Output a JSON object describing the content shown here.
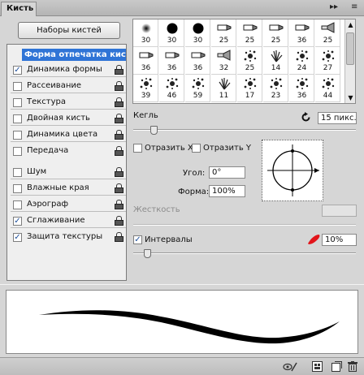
{
  "panel": {
    "tab_label": "Кисть",
    "menu_arrows": "▸▸",
    "menu_icon": "≡"
  },
  "presets_button": "Наборы кистей",
  "options": {
    "header": "Форма отпечатка кисти",
    "items": [
      {
        "label": "Динамика формы",
        "checked": true,
        "check": "✓"
      },
      {
        "label": "Рассеивание",
        "checked": false,
        "check": ""
      },
      {
        "label": "Текстура",
        "checked": false,
        "check": ""
      },
      {
        "label": "Двойная кисть",
        "checked": false,
        "check": ""
      },
      {
        "label": "Динамика цвета",
        "checked": false,
        "check": ""
      },
      {
        "label": "Передача",
        "checked": false,
        "check": ""
      },
      {
        "label": "Шум",
        "checked": false,
        "check": ""
      },
      {
        "label": "Влажные края",
        "checked": false,
        "check": ""
      },
      {
        "label": "Аэрограф",
        "checked": false,
        "check": ""
      },
      {
        "label": "Сглаживание",
        "checked": true,
        "check": "✓"
      },
      {
        "label": "Защита текстуры",
        "checked": true,
        "check": "✓"
      }
    ]
  },
  "brush_tips": [
    {
      "size": "30",
      "icon": "soft-dot"
    },
    {
      "size": "30",
      "icon": "hard-dot"
    },
    {
      "size": "30",
      "icon": "hard-dot"
    },
    {
      "size": "25",
      "icon": "marker-tip"
    },
    {
      "size": "25",
      "icon": "marker-tip"
    },
    {
      "size": "25",
      "icon": "marker-tip"
    },
    {
      "size": "36",
      "icon": "marker-tip"
    },
    {
      "size": "25",
      "icon": "fan-tip"
    },
    {
      "size": "36",
      "icon": "marker-tip"
    },
    {
      "size": "36",
      "icon": "marker-tip"
    },
    {
      "size": "36",
      "icon": "marker-tip"
    },
    {
      "size": "32",
      "icon": "fan-tip"
    },
    {
      "size": "25",
      "icon": "splatter"
    },
    {
      "size": "14",
      "icon": "grass"
    },
    {
      "size": "24",
      "icon": "splatter"
    },
    {
      "size": "27",
      "icon": "splatter"
    },
    {
      "size": "39",
      "icon": "splatter"
    },
    {
      "size": "46",
      "icon": "splatter"
    },
    {
      "size": "59",
      "icon": "splatter"
    },
    {
      "size": "11",
      "icon": "grass"
    },
    {
      "size": "17",
      "icon": "splatter"
    },
    {
      "size": "23",
      "icon": "splatter"
    },
    {
      "size": "36",
      "icon": "splatter"
    },
    {
      "size": "44",
      "icon": "splatter"
    }
  ],
  "size": {
    "label": "Кегль",
    "value": "15 пикс.",
    "reset_icon": "reset-icon",
    "level": 0.08
  },
  "flip": {
    "x_label": "Отразить X",
    "y_label": "Отразить Y"
  },
  "angle": {
    "label": "Угол:",
    "value": "0°"
  },
  "roundness": {
    "label": "Форма:",
    "value": "100%"
  },
  "hardness": {
    "label": "Жесткость"
  },
  "spacing": {
    "label": "Интервалы",
    "value": "10%",
    "checked": true,
    "check": "✓",
    "level": 0.05
  },
  "colors": {
    "selection": "#2f74d6",
    "spacing_blob": "#e2151b"
  }
}
